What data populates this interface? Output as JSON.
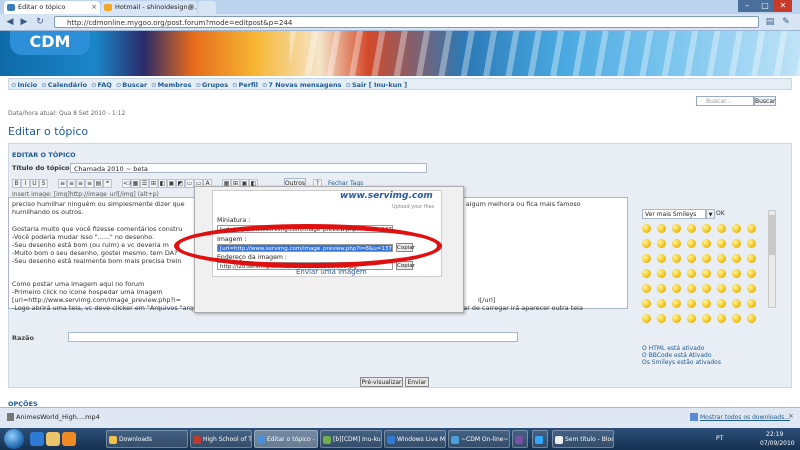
{
  "browser": {
    "tabs": [
      {
        "label": "Editar o tópico",
        "active": true
      },
      {
        "label": "Hotmail - shinoidesign@...",
        "active": false
      },
      {
        "label": "",
        "active": false
      }
    ],
    "url": "http://cdmonline.mygoo.org/post.forum?mode=editpost&p=244",
    "window_controls": [
      "–",
      "□",
      "✕"
    ]
  },
  "banner": {
    "logo": "CDM"
  },
  "forum_nav": [
    "Início",
    "Calendário",
    "FAQ",
    "Buscar",
    "Membros",
    "Grupos",
    "Perfil",
    "7 Novas mensagens",
    "Sair [ Inu-kun ]"
  ],
  "search": {
    "placeholder": "Buscar...",
    "button": "Buscar"
  },
  "datetime": "Data/hora atual: Qua 8 Set 2010 - 1:12",
  "page_title": "Editar o tópico",
  "editor": {
    "header": "EDITAR O TÓPICO",
    "title_label": "Título do tópico",
    "title_value": "Chamada 2010 ~ beta",
    "toolbar": [
      "B",
      "I",
      "U",
      "S",
      "≡",
      "≡",
      "≡",
      "≡",
      "▤",
      "❝",
      "<>",
      "▦",
      "☰",
      "⊞",
      "◧",
      "▣",
      "◩",
      "▭",
      "▭",
      "A",
      "▦",
      "⊞",
      "▣",
      "◧",
      "?"
    ],
    "outros": "Outros",
    "fechar": "Fechar Tags",
    "insert_hint": "Insert image: [img]http://image_url[/img] (alt+p)",
    "message_lines": [
      "preciso humilhar ninguém ou simplesmente dizer que",
      "Gostaria muito que você fizesse comentários constru",
      "-Você poderia mudar isso \"......\" no desenho.",
      "-Seu desenho está bom (ou ruim) e vc deveria m",
      "-Muito bom o seu desenho, gostei mesmo, tem DA?",
      "-Seu desenho está realmente bom mais precisa trein",
      "Como postar uma imagem aqui no forum",
      "-Primeiro click no icone hospedar uma imagem",
      "[url=http://www.servimg.com/image_preview.php?i=",
      "-Logo abrirá uma tela, vc deve clicker em \"Arquivos \"arquivo do seu computador\" escolha o arquivo e depois click em enviar. Quando terminar de carregar irá aparecer outra tela"
    ],
    "message_right_1": "sta algum melhora ou fica mais famoso",
    "message_right_2": "humilhando os outros.",
    "message_right_3": "l[/url]"
  },
  "smileys": {
    "select": "Ver mais Smileys",
    "ok": "OK",
    "count": 56,
    "status": [
      "O HTML está ativado",
      "O BBCode está Ativado",
      "Os Smileys estão ativados"
    ]
  },
  "popup": {
    "brand": "www.servimg.com",
    "tagline": "Upload your files",
    "miniatura_label": "Miniatura :",
    "miniatura_value": "[url=http://www.servimg.com/image_preview.php?i=8&u=137...",
    "imagem_label": "Imagem :",
    "imagem_value": "[url=http://www.servimg.com/image_preview.php?i=8&u=13708890][img]",
    "endereco_label": "Endereço da imagem :",
    "endereco_value": "http://i20.servimg.com/u/f20/13/70/88/90/000.jpg",
    "copiar": "Copiar",
    "enviar": "Enviar uma imagem"
  },
  "razao_label": "Razão",
  "buttons": {
    "preview": "Pré-visualizar",
    "send": "Enviar"
  },
  "opcoes": "OPÇÕES",
  "downloads": {
    "item": "AnimesWorld_High....mp4",
    "show_all": "Mostrar todos os downloads..."
  },
  "taskbar": {
    "buttons": [
      "Downloads",
      "High School of T...",
      "Editar o tópico - ...",
      "[b][CDM] Inu-kun...",
      "Windows Live Me...",
      "~CDM On-line~...",
      "",
      "",
      "Sem título - Bloco..."
    ],
    "lang": "PT",
    "time": "22:19",
    "date": "07/09/2010"
  }
}
